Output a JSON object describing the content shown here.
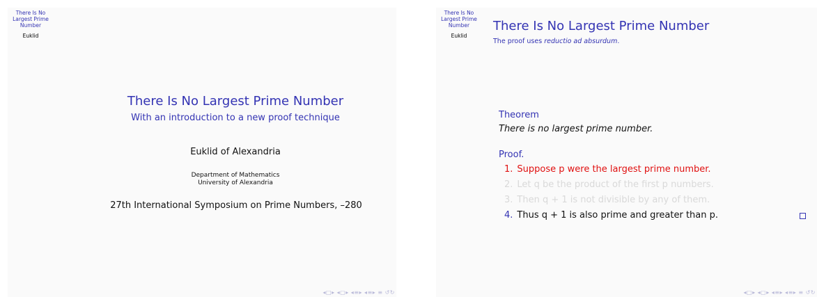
{
  "slide1": {
    "sidebar": {
      "title_lines": [
        "There Is No",
        "Largest Prime",
        "Number"
      ],
      "author": "Euklid"
    },
    "title": "There Is No Largest Prime Number",
    "subtitle": "With an introduction to a new proof technique",
    "author": "Euklid of Alexandria",
    "institute_lines": [
      "Department of Mathematics",
      "University of Alexandria"
    ],
    "date": "27th International Symposium on Prime Numbers, –280",
    "nav_symbols": "◂□▸ ◂▢▸ ◂≡▸ ◂≡▸  ≡  ↺↻"
  },
  "slide2": {
    "sidebar": {
      "title_lines": [
        "There Is No",
        "Largest Prime",
        "Number"
      ],
      "author": "Euklid"
    },
    "frame_title": "There Is No Largest Prime Number",
    "frame_subtitle_prefix": "The proof uses ",
    "frame_subtitle_emph": "reductio ad absurdum",
    "frame_subtitle_suffix": ".",
    "theorem_heading": "Theorem",
    "theorem_body": "There is no largest prime number.",
    "proof_heading": "Proof.",
    "steps": [
      {
        "num": "1.",
        "text": "Suppose p were the largest prime number.",
        "state": "highlighted"
      },
      {
        "num": "2.",
        "text": "Let q be the product of the first p numbers.",
        "state": "dimmed"
      },
      {
        "num": "3.",
        "text": "Then q + 1 is not divisible by any of them.",
        "state": "dimmed"
      },
      {
        "num": "4.",
        "text": "Thus q + 1 is also prime and greater than p.",
        "state": "normal"
      }
    ],
    "qed_symbol": "qed-box",
    "nav_symbols": "◂□▸ ◂▢▸ ◂≡▸ ◂≡▸  ≡  ↺↻"
  },
  "colors": {
    "structure": "#3333b3",
    "alert": "#e01010",
    "dimmed": "#d9d9d9"
  }
}
